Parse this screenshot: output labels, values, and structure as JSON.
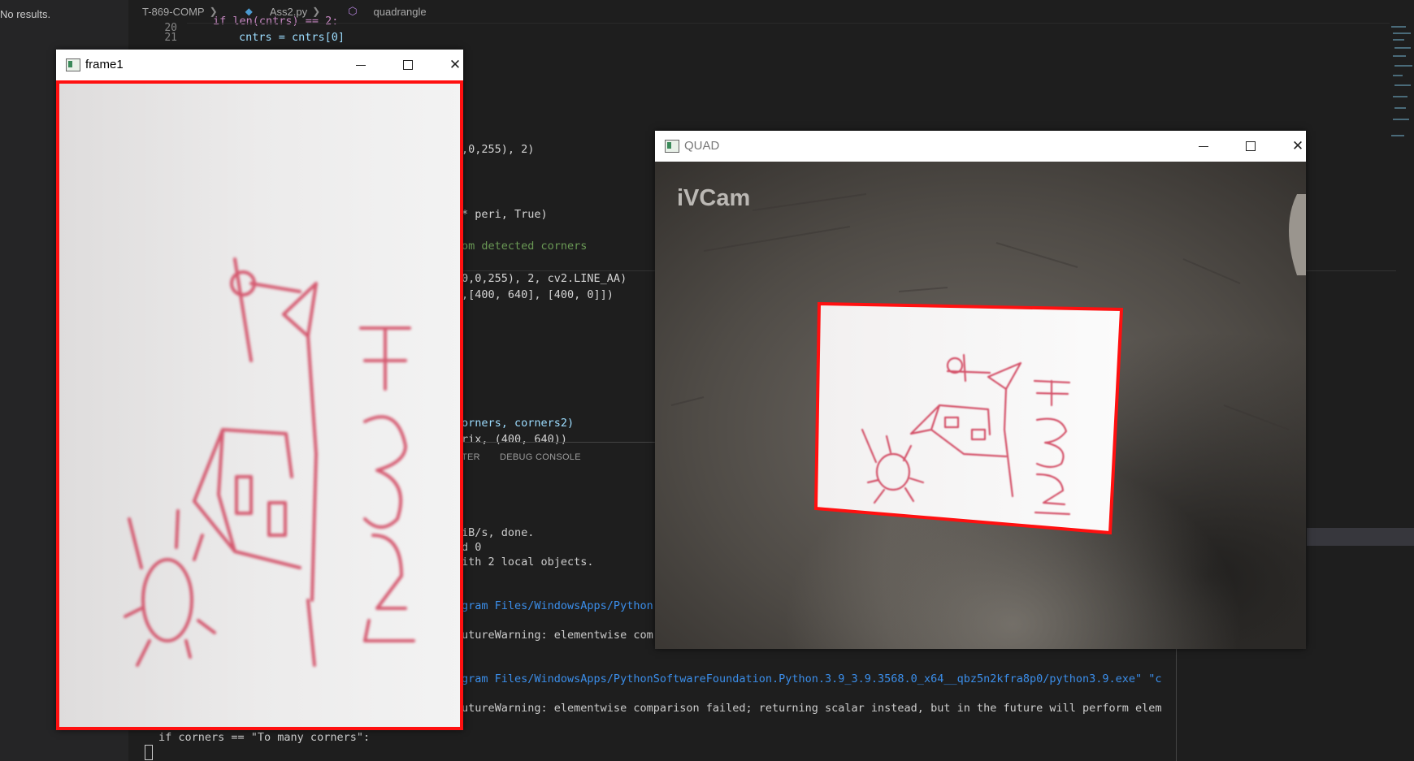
{
  "search": {
    "no_results": "No results."
  },
  "breadcrumb": {
    "folder": "T-869-COMP",
    "file": "Ass2.py",
    "symbol": "quadrangle"
  },
  "editor": {
    "line_numbers": [
      "20",
      "21"
    ],
    "line20": "if len(cntrs) == 2:",
    "line21": "cntrs = cntrs[0]",
    "frag1": ",0,255), 2)",
    "frag2": "* peri, True)",
    "frag3": "om detected corners",
    "frag4": "0,0,255), 2, cv2.LINE_AA)",
    "frag5": ",[400, 640], [400, 0]])",
    "frag6": "orners, corners2)",
    "frag7": "rix, (400, 640))"
  },
  "panel": {
    "tab_partial": "TER",
    "tab_debug": "DEBUG CONSOLE"
  },
  "terminal": {
    "l1": "iB/s, done.",
    "l2": "d 0",
    "l3": "ith 2 local objects.",
    "l4": "gram Files/WindowsApps/Python",
    "l5": "utureWarning: elementwise com",
    "l6": "gram Files/WindowsApps/PythonSoftwareFoundation.Python.3.9_3.9.3568.0_x64__qbz5n2kfra8p0/python3.9.exe\" \"c",
    "l7": "utureWarning: elementwise comparison failed; returning scalar instead, but in the future will perform elem",
    "l8": "if corners == \"To many corners\":"
  },
  "frame1": {
    "title": "frame1"
  },
  "quad": {
    "title": "QUAD",
    "watermark": "iVCam"
  },
  "colors": {
    "outline": "#ff1010",
    "ink": "#d0405a",
    "vscode_bg": "#1e1e1e"
  }
}
